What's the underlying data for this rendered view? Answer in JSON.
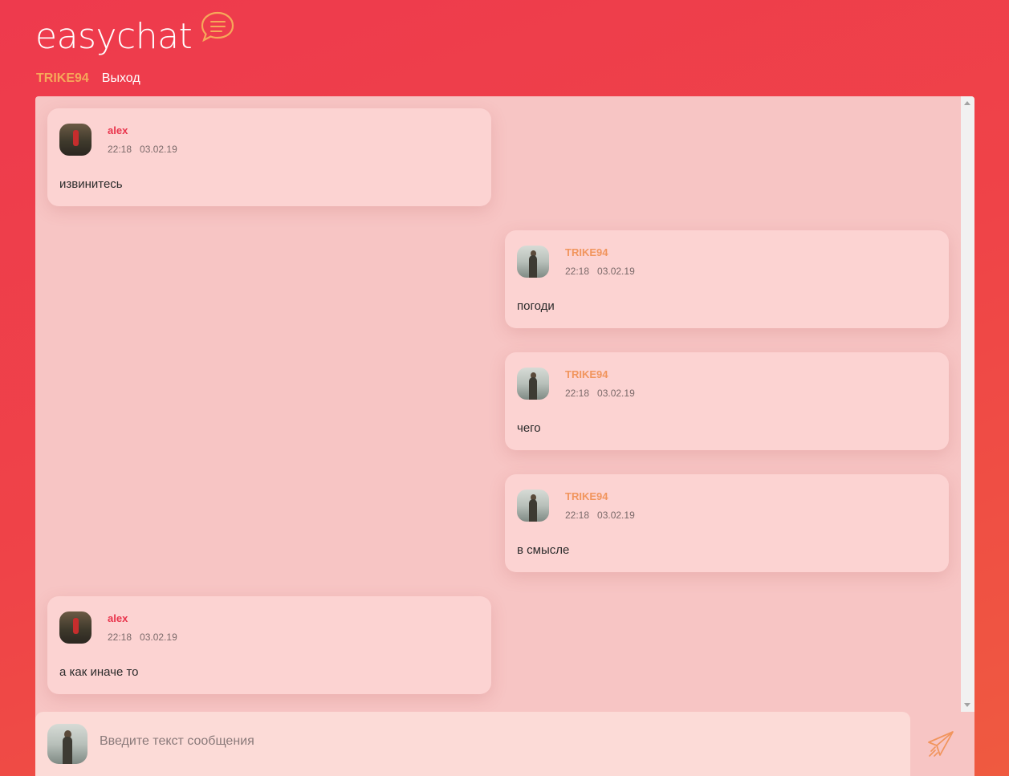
{
  "app": {
    "logo_text": "easychat",
    "logo_icon": "chat-bubble-icon",
    "brand_color": "#ee3a4d",
    "accent_color": "#f1955d"
  },
  "nav": {
    "username": "TRIKE94",
    "logout_label": "Выход"
  },
  "messages": [
    {
      "author": "alex",
      "time": "22:18",
      "date": "03.02.19",
      "text": "извинитесь",
      "side": "left"
    },
    {
      "author": "TRIKE94",
      "time": "22:18",
      "date": "03.02.19",
      "text": "погоди",
      "side": "right"
    },
    {
      "author": "TRIKE94",
      "time": "22:18",
      "date": "03.02.19",
      "text": "чего",
      "side": "right"
    },
    {
      "author": "TRIKE94",
      "time": "22:18",
      "date": "03.02.19",
      "text": "в смысле",
      "side": "right"
    },
    {
      "author": "alex",
      "time": "22:18",
      "date": "03.02.19",
      "text": "а как иначе то",
      "side": "left"
    }
  ],
  "composer": {
    "placeholder": "Введите текст сообщения",
    "value": "",
    "send_icon": "paper-plane-icon"
  }
}
